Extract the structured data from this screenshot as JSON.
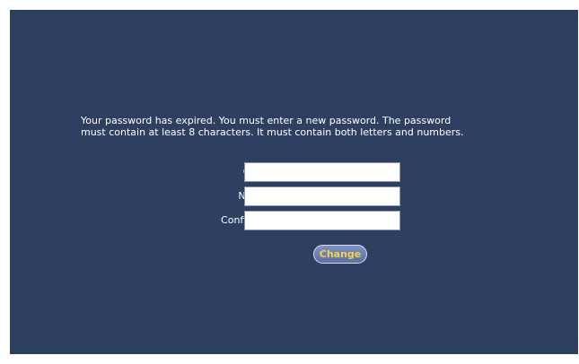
{
  "message": "Your password has expired. You must enter a new password. The password must contain at least 8 characters. It must contain both letters and numbers.",
  "form": {
    "old_password_label": "Old Password:",
    "new_password_label": "New Password:",
    "confirm_password_label": "Confirm Password:",
    "old_password_value": "",
    "new_password_value": "",
    "confirm_password_value": "",
    "change_button_label": "Change"
  },
  "colors": {
    "background": "#2e3f62",
    "text": "#ffffff",
    "button_text": "#f2d43a",
    "button_fill": "#6a7bb4"
  }
}
